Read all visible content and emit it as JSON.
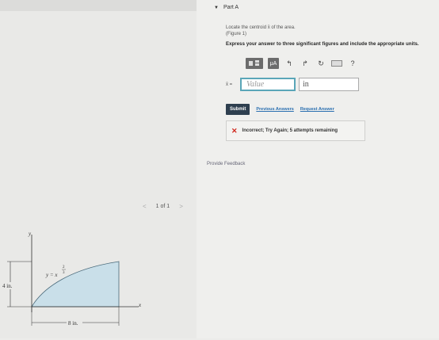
{
  "part": {
    "label": "Part A"
  },
  "problem": {
    "prompt": "Locate the centroid x̄ of the area.",
    "figure_link": "(Figure 1)",
    "instructions": "Express your answer to three significant figures and include the appropriate units."
  },
  "toolbar": {
    "mu_label": "μA",
    "undo": "↰",
    "redo": "↱",
    "reset": "↻",
    "help": "?"
  },
  "answer": {
    "label": "x̄ =",
    "value_placeholder": "Value",
    "unit_value": "in"
  },
  "actions": {
    "submit": "Submit",
    "previous_answers": "Previous Answers",
    "request_answer": "Request Answer"
  },
  "feedback": {
    "text": "Incorrect; Try Again; 5 attempts remaining"
  },
  "provide_feedback": "Provide Feedback",
  "pager": {
    "text": "1 of 1",
    "prev": "<",
    "next": ">"
  },
  "figure": {
    "y_axis": "y",
    "x_axis": "x",
    "equation": "y = x",
    "exponent_num": "2",
    "exponent_den": "3",
    "height_dim": "4 in.",
    "width_dim": "8 in."
  },
  "colors": {
    "accent": "#5aa6b8",
    "error": "#d0271d",
    "submit_bg": "#2e3f4f",
    "shade": "#c9dfe9"
  }
}
